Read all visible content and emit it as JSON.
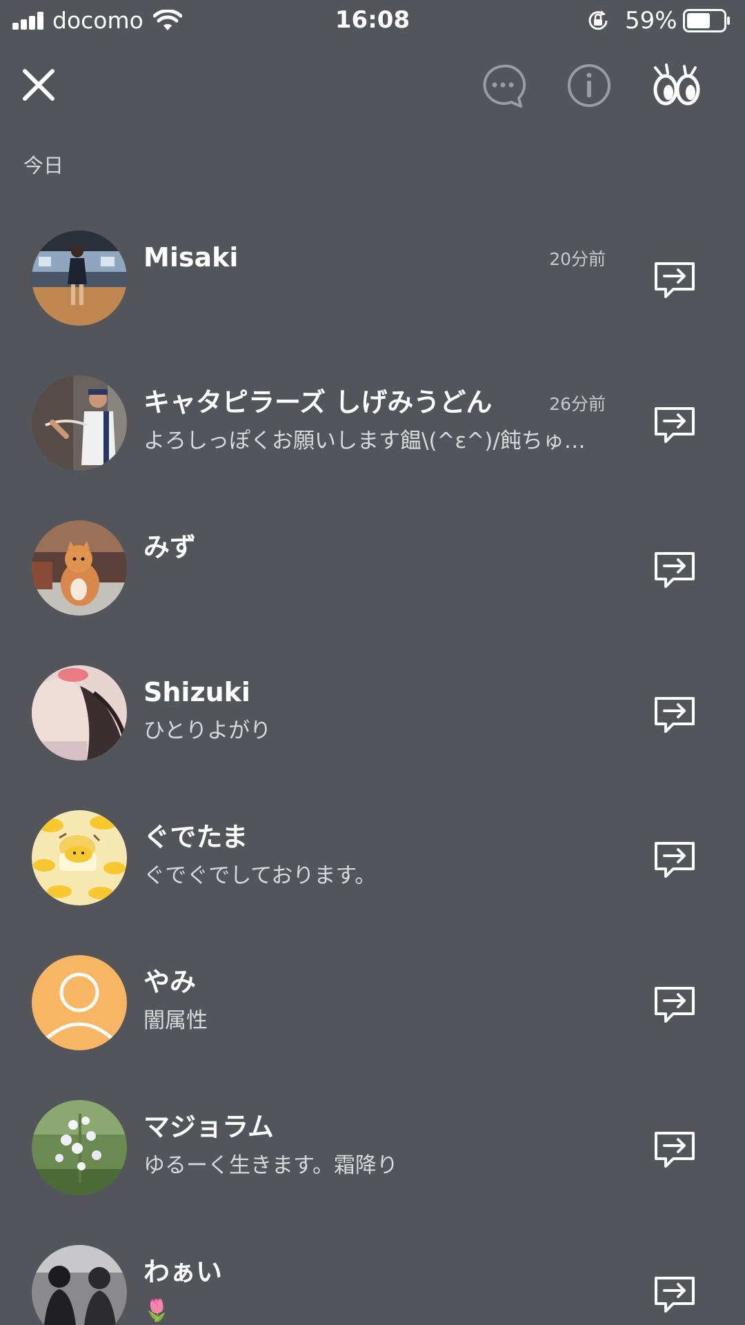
{
  "status_bar": {
    "carrier": "docomo",
    "time": "16:08",
    "battery": "59%"
  },
  "colors": {
    "background": "#52555a",
    "default_avatar": "#f8b664"
  },
  "section": {
    "label": "今日"
  },
  "friends": [
    {
      "name": "Misaki",
      "message": "",
      "time": "20分前"
    },
    {
      "name": "キャタピラーズ しげみうどん",
      "message": "よろしっぽくお願いします饂\\(^ε^)/飩ちゅ…",
      "time": "26分前"
    },
    {
      "name": "みず",
      "message": "",
      "time": ""
    },
    {
      "name": "Shizuki",
      "message": "ひとりよがり",
      "time": ""
    },
    {
      "name": "ぐでたま",
      "message": "ぐでぐでしております。",
      "time": ""
    },
    {
      "name": "やみ",
      "message": "闇属性",
      "time": ""
    },
    {
      "name": "マジョラム",
      "message": "ゆるーく生きます。霜降り",
      "time": ""
    },
    {
      "name": "わぁい",
      "message": "🌷",
      "time": ""
    }
  ]
}
